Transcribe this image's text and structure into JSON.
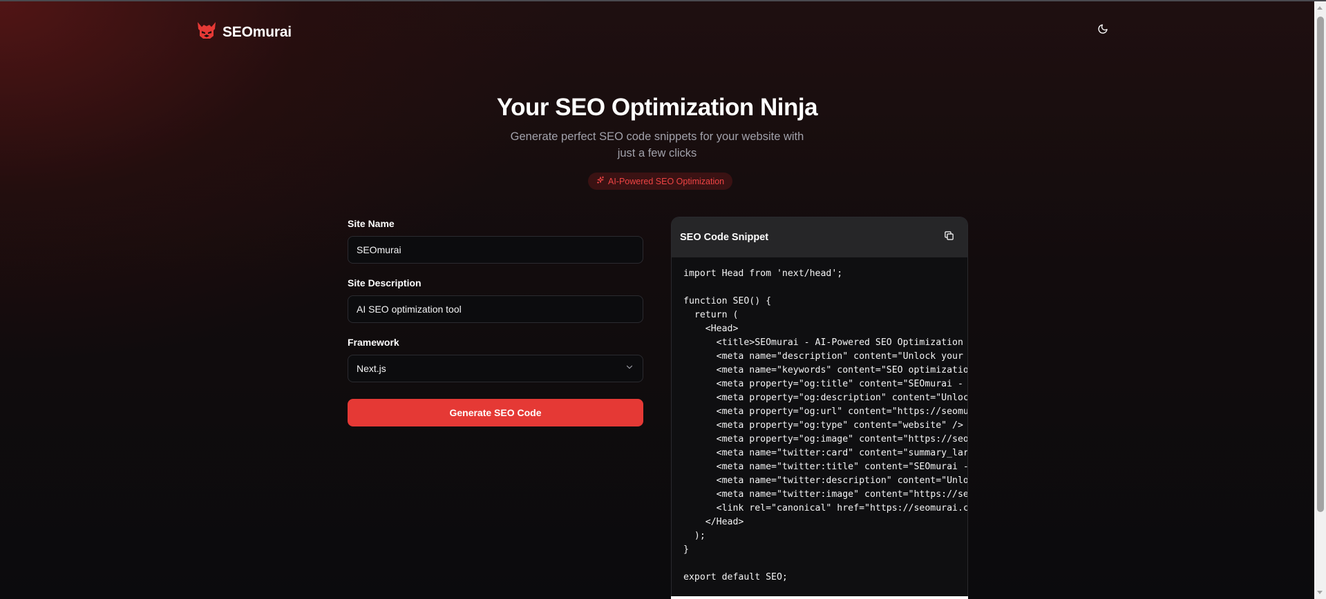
{
  "brand": {
    "name": "SEOmurai",
    "logo_icon": "samurai-helmet-icon",
    "accent_color": "#e53935"
  },
  "header": {
    "theme_toggle_icon": "moon-icon"
  },
  "hero": {
    "title": "Your SEO Optimization Ninja",
    "subtitle": "Generate perfect SEO code snippets for your website with just a few clicks",
    "badge_icon": "sparkles-icon",
    "badge_text": "AI-Powered SEO Optimization"
  },
  "form": {
    "site_name_label": "Site Name",
    "site_name_value": "SEOmurai",
    "site_description_label": "Site Description",
    "site_description_value": "AI SEO optimization tool",
    "framework_label": "Framework",
    "framework_value": "Next.js",
    "generate_button": "Generate SEO Code"
  },
  "code_panel": {
    "title": "SEO Code Snippet",
    "copy_icon": "copy-icon",
    "lines": [
      "import Head from 'next/head';",
      "",
      "function SEO() {",
      "  return (",
      "    <Head>",
      "      <title>SEOmurai - AI-Powered SEO Optimization To",
      "      <meta name=\"description\" content=\"Unlock your we",
      "      <meta name=\"keywords\" content=\"SEO optimization,",
      "      <meta property=\"og:title\" content=\"SEOmurai - AI",
      "      <meta property=\"og:description\" content=\"Unlock",
      "      <meta property=\"og:url\" content=\"https://seomura",
      "      <meta property=\"og:type\" content=\"website\" />",
      "      <meta property=\"og:image\" content=\"https://seomu",
      "      <meta name=\"twitter:card\" content=\"summary_large",
      "      <meta name=\"twitter:title\" content=\"SEOmurai - A",
      "      <meta name=\"twitter:description\" content=\"Unlock",
      "      <meta name=\"twitter:image\" content=\"https://seom",
      "      <link rel=\"canonical\" href=\"https://seomurai.co",
      "    </Head>",
      "  );",
      "}",
      "",
      "export default SEO;"
    ]
  }
}
